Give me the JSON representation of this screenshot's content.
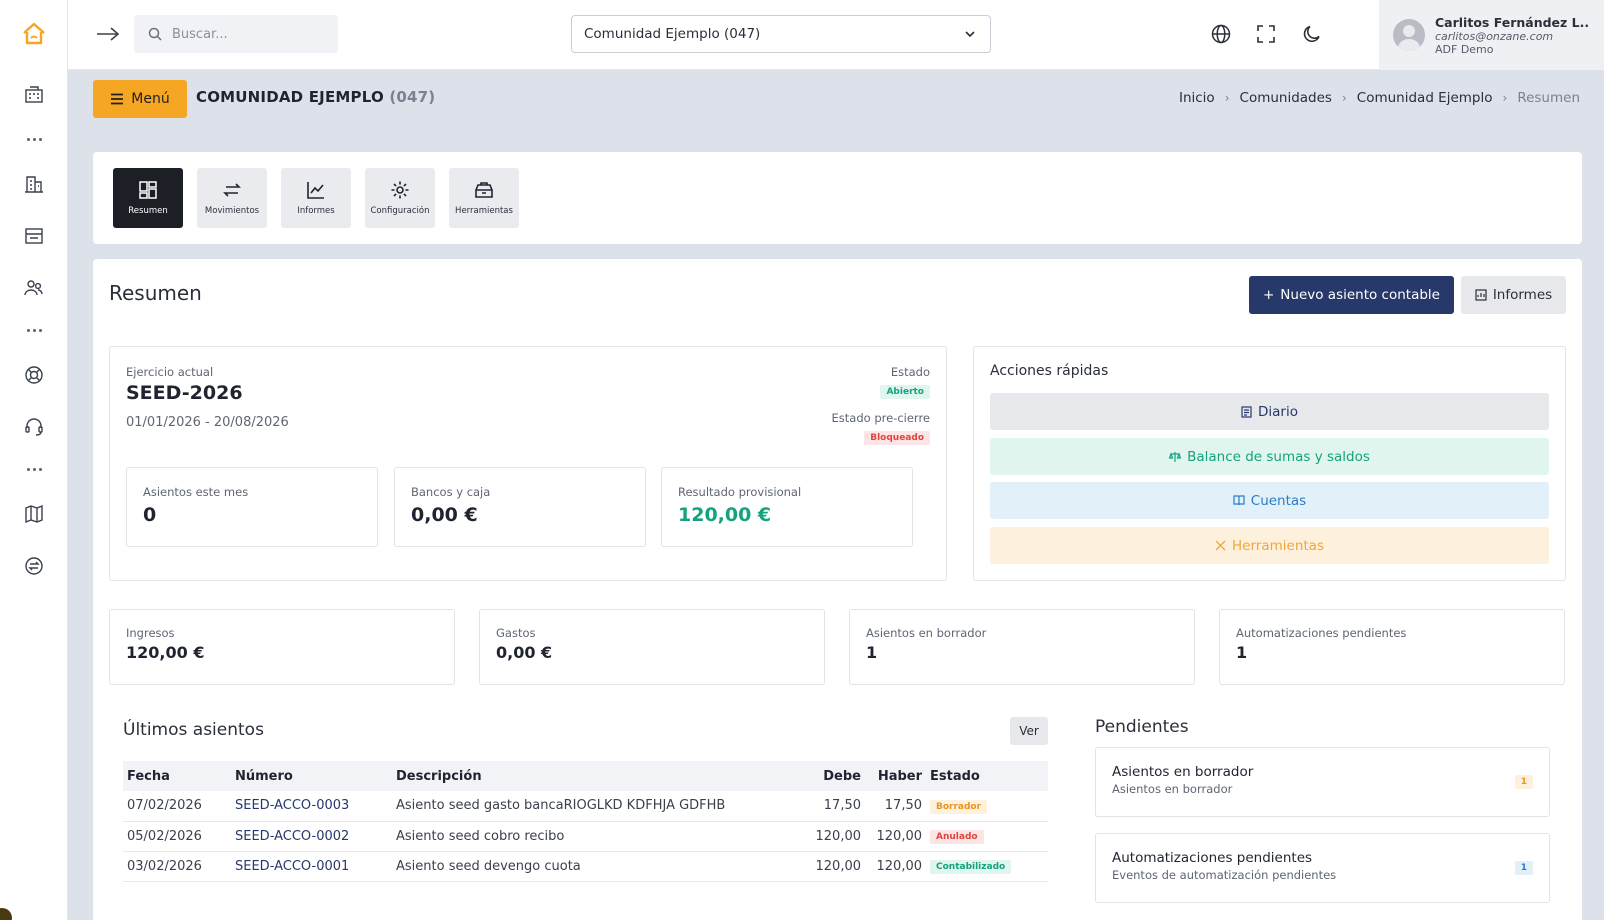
{
  "topbar": {
    "search_placeholder": "Buscar...",
    "community_selected": "Comunidad Ejemplo (047)",
    "user": {
      "name": "Carlitos Fernández L..",
      "email": "carlitos@onzane.com",
      "org": "ADF Demo"
    }
  },
  "header": {
    "menu_label": "Menú",
    "title": "COMUNIDAD EJEMPLO",
    "title_code": "(047)",
    "breadcrumb": [
      "Inicio",
      "Comunidades",
      "Comunidad Ejemplo",
      "Resumen"
    ]
  },
  "tools": [
    {
      "label": "Resumen",
      "icon": "dashboard-icon"
    },
    {
      "label": "Movimientos",
      "icon": "swap-arrows-icon"
    },
    {
      "label": "Informes",
      "icon": "line-chart-icon"
    },
    {
      "label": "Configuración",
      "icon": "gear-icon"
    },
    {
      "label": "Herramientas",
      "icon": "toolbox-icon"
    }
  ],
  "resumen": {
    "title": "Resumen",
    "new_button": "Nuevo asiento contable",
    "reports_button": "Informes",
    "ejercicio": {
      "label": "Ejercicio actual",
      "name": "SEED-2026",
      "dates": "01/01/2026 - 20/08/2026",
      "estado_label": "Estado",
      "estado": "Abierto",
      "precierre_label": "Estado pre-cierre",
      "precierre": "Bloqueado"
    },
    "mini_stats": [
      {
        "label": "Asientos este mes",
        "value": "0"
      },
      {
        "label": "Bancos y caja",
        "value": "0,00 €"
      },
      {
        "label": "Resultado provisional",
        "value": "120,00 €"
      }
    ],
    "quick_actions": {
      "title": "Acciones rápidas",
      "items": [
        "Diario",
        "Balance de sumas y saldos",
        "Cuentas",
        "Herramientas"
      ]
    },
    "stats": [
      {
        "label": "Ingresos",
        "value": "120,00 €"
      },
      {
        "label": "Gastos",
        "value": "0,00 €"
      },
      {
        "label": "Asientos en borrador",
        "value": "1"
      },
      {
        "label": "Automatizaciones pendientes",
        "value": "1"
      }
    ],
    "ultimos": {
      "title": "Últimos asientos",
      "ver_label": "Ver",
      "columns": [
        "Fecha",
        "Número",
        "Descripción",
        "Debe",
        "Haber",
        "Estado"
      ],
      "rows": [
        {
          "fecha": "07/02/2026",
          "numero": "SEED-ACCO-0003",
          "descripcion": "Asiento seed gasto bancaRIOGLKD KDFHJA GDFHB",
          "debe": "17,50",
          "haber": "17,50",
          "estado": "Borrador"
        },
        {
          "fecha": "05/02/2026",
          "numero": "SEED-ACCO-0002",
          "descripcion": "Asiento seed cobro recibo",
          "debe": "120,00",
          "haber": "120,00",
          "estado": "Anulado"
        },
        {
          "fecha": "03/02/2026",
          "numero": "SEED-ACCO-0001",
          "descripcion": "Asiento seed devengo cuota",
          "debe": "120,00",
          "haber": "120,00",
          "estado": "Contabilizado"
        }
      ]
    },
    "pendientes": {
      "title": "Pendientes",
      "items": [
        {
          "title": "Asientos en borrador",
          "subtitle": "Asientos en borrador",
          "count": "1"
        },
        {
          "title": "Automatizaciones pendientes",
          "subtitle": "Eventos de automatización pendientes",
          "count": "1"
        }
      ]
    }
  },
  "colors": {
    "accent_orange": "#f5a623",
    "primary_navy": "#27386a",
    "success_green": "#14a37f",
    "danger_red": "#e0453c"
  }
}
